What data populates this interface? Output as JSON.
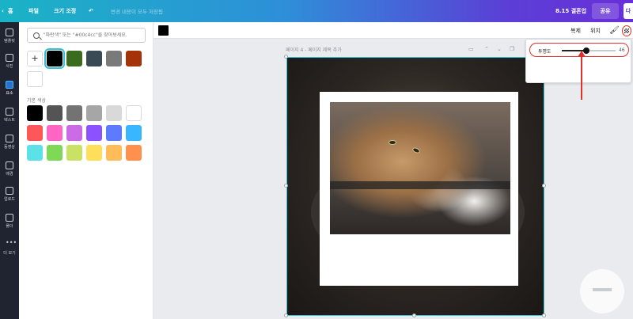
{
  "topbar": {
    "back_icon": "chevron-left-icon",
    "home": "홈",
    "file": "파일",
    "resize": "크기 조정",
    "undo_icon": "undo-icon",
    "status": "변경 내용이 모두 저장됨",
    "days_left": "8.15 결혼업",
    "share": "공유",
    "download": "다"
  },
  "rail": [
    {
      "icon": "template-icon",
      "label": "템플릿"
    },
    {
      "icon": "photo-icon",
      "label": "사진"
    },
    {
      "icon": "elements-icon",
      "label": "요소"
    },
    {
      "icon": "text-icon",
      "label": "텍스트"
    },
    {
      "icon": "video-icon",
      "label": "동영상"
    },
    {
      "icon": "background-icon",
      "label": "배경"
    },
    {
      "icon": "upload-icon",
      "label": "업로드"
    },
    {
      "icon": "folder-icon",
      "label": "폴더"
    },
    {
      "icon": "more-icon",
      "label": "더 보기"
    }
  ],
  "panel": {
    "search_placeholder": "\"파란색\" 또는 \"#00c4cc\"를 찾아보세요.",
    "section_label": "기본 색상",
    "document_colors": [
      "#000000",
      "#3b6b1f",
      "#3a4a55",
      "#7a7a7a",
      "#a6320a",
      "#ffffff"
    ],
    "default_colors": [
      "#000000",
      "#545454",
      "#737373",
      "#a6a6a6",
      "#d9d9d9",
      "#ffffff",
      "#ff5757",
      "#ff66c4",
      "#cb6ce6",
      "#8c52ff",
      "#5e7bff",
      "#38b6ff",
      "#5ce1e6",
      "#7ed957",
      "#c9e265",
      "#ffde59",
      "#ffbd59",
      "#ff914d"
    ]
  },
  "toolbar2": {
    "current_color": "#000000",
    "duplicate": "복제",
    "position": "위치",
    "paint_icon": "paint-roller-icon",
    "transparency_icon": "transparency-checker-icon"
  },
  "page": {
    "label": "페이지 4 - 페이지 제목 추가"
  },
  "transparency": {
    "label": "투명도",
    "value": "46",
    "level": 46
  },
  "colors": {
    "accent": "#2ec4d6",
    "annotation": "#e0302b"
  }
}
